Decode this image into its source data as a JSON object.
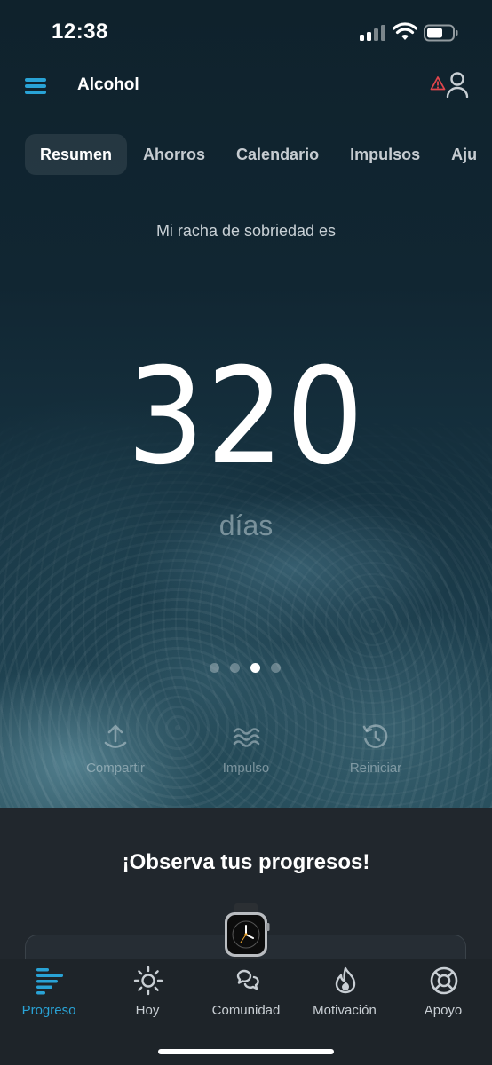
{
  "status_bar": {
    "time": "12:38"
  },
  "header": {
    "title": "Alcohol"
  },
  "tabs": [
    {
      "label": "Resumen",
      "active": true
    },
    {
      "label": "Ahorros",
      "active": false
    },
    {
      "label": "Calendario",
      "active": false
    },
    {
      "label": "Impulsos",
      "active": false
    },
    {
      "label": "Aju",
      "active": false
    }
  ],
  "streak": {
    "label": "Mi racha de sobriedad es",
    "value": "320",
    "unit": "días"
  },
  "pager": {
    "count": 4,
    "active_index": 2
  },
  "actions": [
    {
      "label": "Compartir",
      "icon": "share-icon"
    },
    {
      "label": "Impulso",
      "icon": "waves-icon"
    },
    {
      "label": "Reiniciar",
      "icon": "history-icon"
    }
  ],
  "panel": {
    "title": "¡Observa tus progresos!"
  },
  "bottom_nav": [
    {
      "label": "Progreso",
      "icon": "progress-icon",
      "active": true
    },
    {
      "label": "Hoy",
      "icon": "sun-icon",
      "active": false
    },
    {
      "label": "Comunidad",
      "icon": "community-icon",
      "active": false
    },
    {
      "label": "Motivación",
      "icon": "flame-icon",
      "active": false
    },
    {
      "label": "Apoyo",
      "icon": "lifebuoy-icon",
      "active": false
    }
  ],
  "colors": {
    "accent": "#29a3d6",
    "warning": "#e0454c",
    "panel_bg": "#21272d"
  }
}
